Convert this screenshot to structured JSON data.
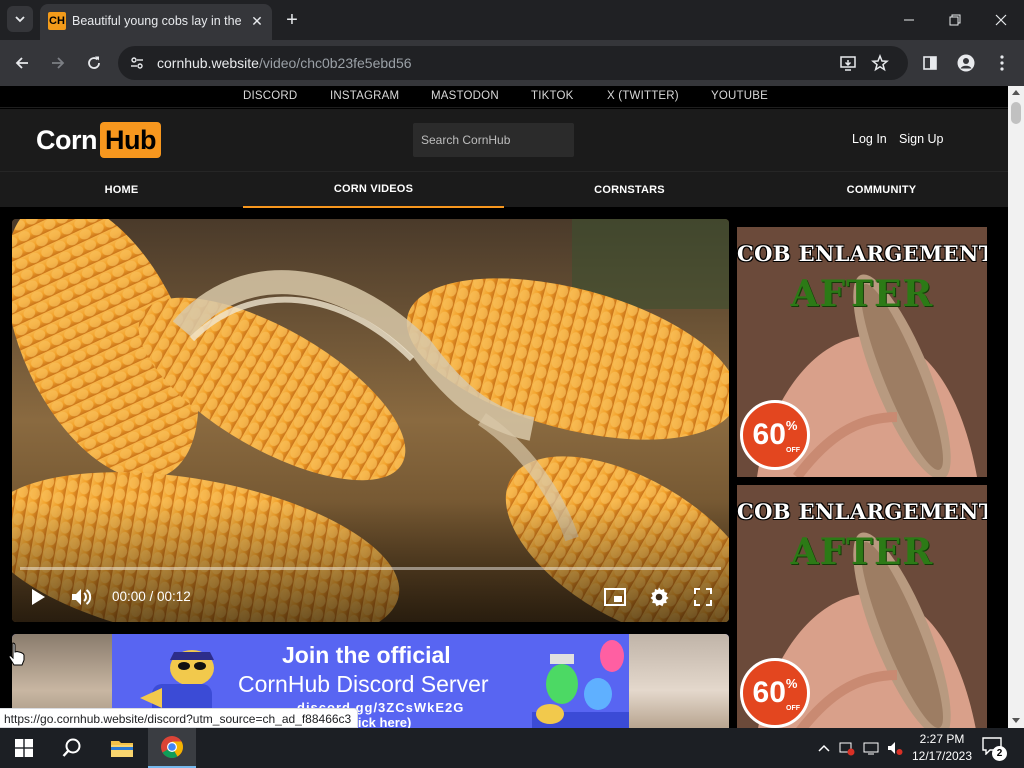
{
  "browser": {
    "tab_title": "Beautiful young cobs lay in the",
    "favicon_text": "CH",
    "url_domain": "cornhub.website",
    "url_path": "/video/chc0b23fe5ebd56",
    "new_tab_symbol": "+",
    "close_tab_symbol": "✕"
  },
  "social_links": [
    "DISCORD",
    "INSTAGRAM",
    "MASTODON",
    "TIKTOK",
    "X (TWITTER)",
    "YOUTUBE"
  ],
  "header": {
    "logo_part1": "Corn",
    "logo_part2": "Hub",
    "search_placeholder": "Search CornHub",
    "login": "Log In",
    "signup": "Sign Up"
  },
  "nav": {
    "items": [
      "HOME",
      "CORN VIDEOS",
      "CORNSTARS",
      "COMMUNITY"
    ],
    "active": "CORN VIDEOS"
  },
  "player": {
    "time": "00:00 / 00:12",
    "progress": 0
  },
  "banner": {
    "line1": "Join the official",
    "line2": "CornHub Discord Server",
    "line3": "discord.gg/3ZCsWkE2G",
    "line4": "click here)"
  },
  "ads": [
    {
      "headline": "COB ENLARGEMENT",
      "sub": "AFTER",
      "discount": "60",
      "discount_unit": "%",
      "discount_label": "OFF"
    },
    {
      "headline": "COB ENLARGEMENT",
      "sub": "AFTER",
      "discount": "60",
      "discount_unit": "%",
      "discount_label": "OFF"
    }
  ],
  "status_url": "https://go.cornhub.website/discord?utm_source=ch_ad_f88466c3",
  "taskbar": {
    "time": "2:27 PM",
    "date": "12/17/2023",
    "notification_count": "2"
  },
  "colors": {
    "accent": "#f7971e",
    "discord": "#5865f2",
    "chrome_dark": "#202124",
    "chrome_toolbar": "#35363a"
  }
}
